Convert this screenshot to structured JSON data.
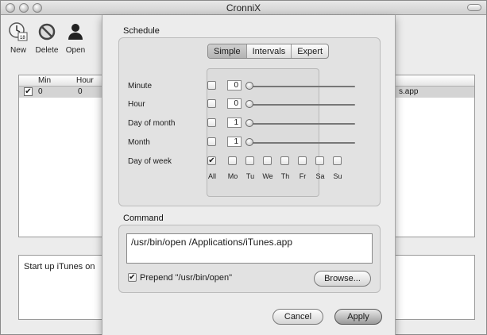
{
  "window": {
    "title": "CronniX"
  },
  "toolbar": {
    "new_label": "New",
    "delete_label": "Delete",
    "open_label": "Open"
  },
  "table": {
    "columns": [
      "Min",
      "Hour"
    ],
    "row": {
      "min": "0",
      "hour": "0",
      "command_tail": "s.app"
    }
  },
  "description": "Start up iTunes on",
  "sheet": {
    "schedule_label": "Schedule",
    "tabs": [
      {
        "label": "Simple",
        "active": true
      },
      {
        "label": "Intervals",
        "active": false
      },
      {
        "label": "Expert",
        "active": false
      }
    ],
    "rows": [
      {
        "label": "Minute",
        "value": "0",
        "checked": false
      },
      {
        "label": "Hour",
        "value": "0",
        "checked": false
      },
      {
        "label": "Day of month",
        "value": "1",
        "checked": false
      },
      {
        "label": "Month",
        "value": "1",
        "checked": false
      }
    ],
    "day_of_week": {
      "label": "Day of week",
      "days": [
        {
          "label": "All",
          "checked": true
        },
        {
          "label": "Mo",
          "checked": false
        },
        {
          "label": "Tu",
          "checked": false
        },
        {
          "label": "We",
          "checked": false
        },
        {
          "label": "Th",
          "checked": false
        },
        {
          "label": "Fr",
          "checked": false
        },
        {
          "label": "Sa",
          "checked": false
        },
        {
          "label": "Su",
          "checked": false
        }
      ]
    },
    "command_label": "Command",
    "command_value": "/usr/bin/open /Applications/iTunes.app",
    "prepend_label": "Prepend \"/usr/bin/open\"",
    "prepend_checked": true,
    "browse_label": "Browse...",
    "cancel_label": "Cancel",
    "apply_label": "Apply"
  }
}
